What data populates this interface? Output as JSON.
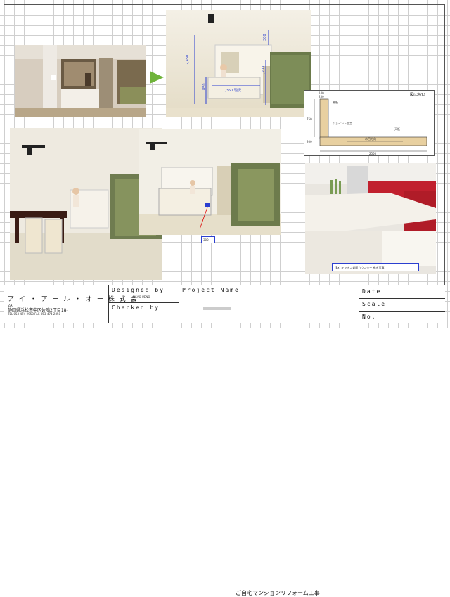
{
  "title_block": {
    "company_name": "ア イ ・ ア ー ル ・ オ ー 株 式 会",
    "company_sub": "2A",
    "address": "静岡県浜松市中区佐鳴2丁目18-",
    "phone_fax": "TEL 053-474-2958   FAX 053-474-2858",
    "designed_by_label": "Designed by",
    "designer_name": "ISAO UENO",
    "checked_by_label": "Checked by",
    "project_name_label": "Project Name",
    "project_name": "ご自宅マンションリフォーム工事",
    "date_label": "Date",
    "scale_label": "Scale",
    "no_label": "No."
  },
  "annotations": {
    "section_height": "2,450",
    "counter_height": "850",
    "counter_width": "1,350 現況",
    "overhead": "300",
    "side_dim": "1,200",
    "callout": "300"
  },
  "detail": {
    "title": "図は左(L)",
    "dim_a": "140",
    "dim_b": "250",
    "dim_h": "750",
    "dim_d": "200",
    "dim_w": "2550",
    "label_top": "幕板",
    "label_joint": "ジョイント加工",
    "label_material": "天板",
    "label_grain": "木目方向"
  },
  "photo_caption": "(Ex) キッチン対面カウンター 参考写真",
  "colors": {
    "arrow": "#6fb33a",
    "dimension": "#2b3fd0",
    "counter": "#e8d0a0",
    "kitchen_red": "#c1202e"
  }
}
